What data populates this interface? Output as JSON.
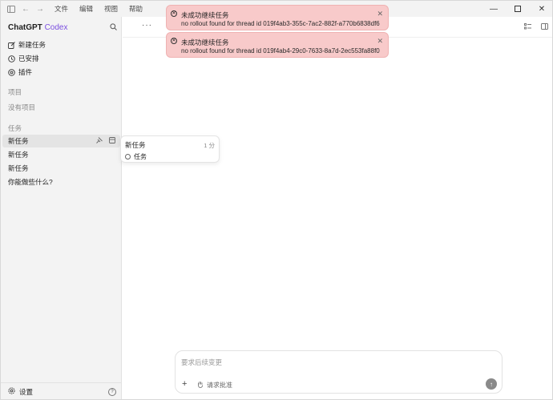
{
  "titlebar": {
    "menus": [
      "文件",
      "编辑",
      "视图",
      "帮助"
    ]
  },
  "sidebar": {
    "brand_main": "ChatGPT",
    "brand_accent": "Codex",
    "nav": [
      {
        "label": "新建任务",
        "icon": "edit-icon"
      },
      {
        "label": "已安排",
        "icon": "clock-icon"
      },
      {
        "label": "插件",
        "icon": "plugin-icon"
      }
    ],
    "projects_label": "项目",
    "no_projects": "没有项目",
    "tasks_label": "任务",
    "tasks": [
      "新任务",
      "新任务",
      "新任务",
      "你能做些什么?"
    ],
    "settings_label": "设置"
  },
  "toasts": [
    {
      "title": "未成功继续任务",
      "body": "no rollout found for thread id 019f4ab3-355c-7ac2-882f-a770b6838df6"
    },
    {
      "title": "未成功继续任务",
      "body": "no rollout found for thread id 019f4ab4-29c0-7633-8a7d-2ec553fa88f0"
    }
  ],
  "popover": {
    "title": "新任务",
    "time": "1 分",
    "item": "任务"
  },
  "composer": {
    "placeholder": "要求后续变更",
    "approve_label": "请求批准"
  },
  "colors": {
    "accent": "#7b4fe0",
    "toast_bg": "#f8caca"
  }
}
